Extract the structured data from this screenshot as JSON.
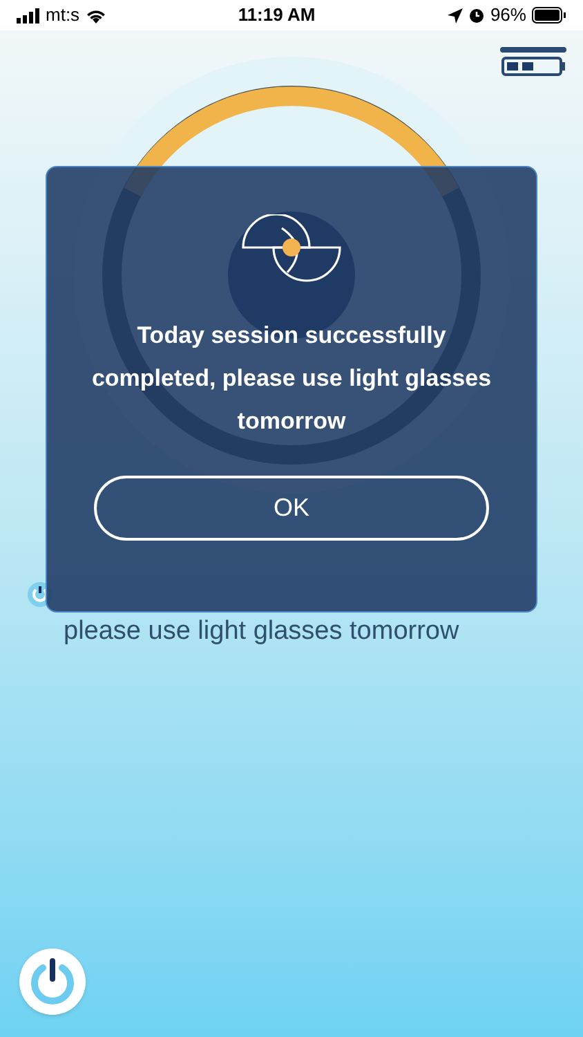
{
  "status_bar": {
    "carrier": "mt:s",
    "time": "11:19 AM",
    "battery": "96%"
  },
  "device_battery": {
    "level": 0.6
  },
  "session_message": "please use light glasses tomorrow",
  "dialog": {
    "message": "Today session successfully completed, please use light glasses tomorrow",
    "button": "OK"
  }
}
